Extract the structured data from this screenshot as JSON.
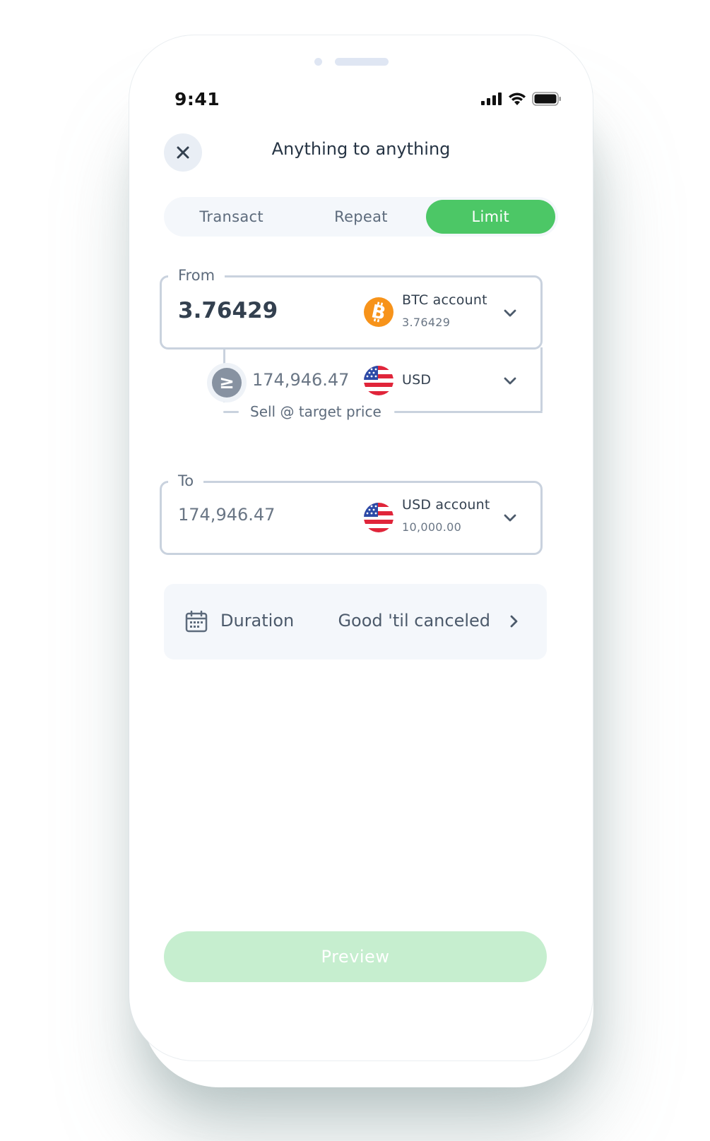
{
  "status_bar": {
    "time": "9:41",
    "signal_icon": "signal-icon",
    "wifi_icon": "wifi-icon",
    "battery_icon": "battery-icon"
  },
  "header": {
    "close_icon": "close-icon",
    "title": "Anything to anything"
  },
  "tabs": [
    {
      "label": "Transact",
      "active": false
    },
    {
      "label": "Repeat",
      "active": false
    },
    {
      "label": "Limit",
      "active": true
    }
  ],
  "from": {
    "label": "From",
    "amount": "3.76429",
    "account_name": "BTC account",
    "account_balance": "3.76429",
    "coin_icon": "bitcoin-icon",
    "chevron_icon": "chevron-down-icon"
  },
  "target": {
    "comparator": "≥",
    "price": "174,946.47",
    "currency": "USD",
    "flag_icon": "us-flag-icon",
    "caption": "Sell @ target price",
    "chevron_icon": "chevron-down-icon"
  },
  "to": {
    "label": "To",
    "amount": "174,946.47",
    "account_name": "USD account",
    "account_balance": "10,000.00",
    "flag_icon": "us-flag-icon",
    "chevron_icon": "chevron-down-icon"
  },
  "duration": {
    "icon": "calendar-icon",
    "label": "Duration",
    "value": "Good 'til canceled",
    "chevron_icon": "chevron-right-icon"
  },
  "preview_button": {
    "label": "Preview"
  },
  "colors": {
    "accent": "#4cc766",
    "accent_disabled": "#c6eecf",
    "bitcoin": "#f7931a",
    "border": "#c9d2de"
  }
}
